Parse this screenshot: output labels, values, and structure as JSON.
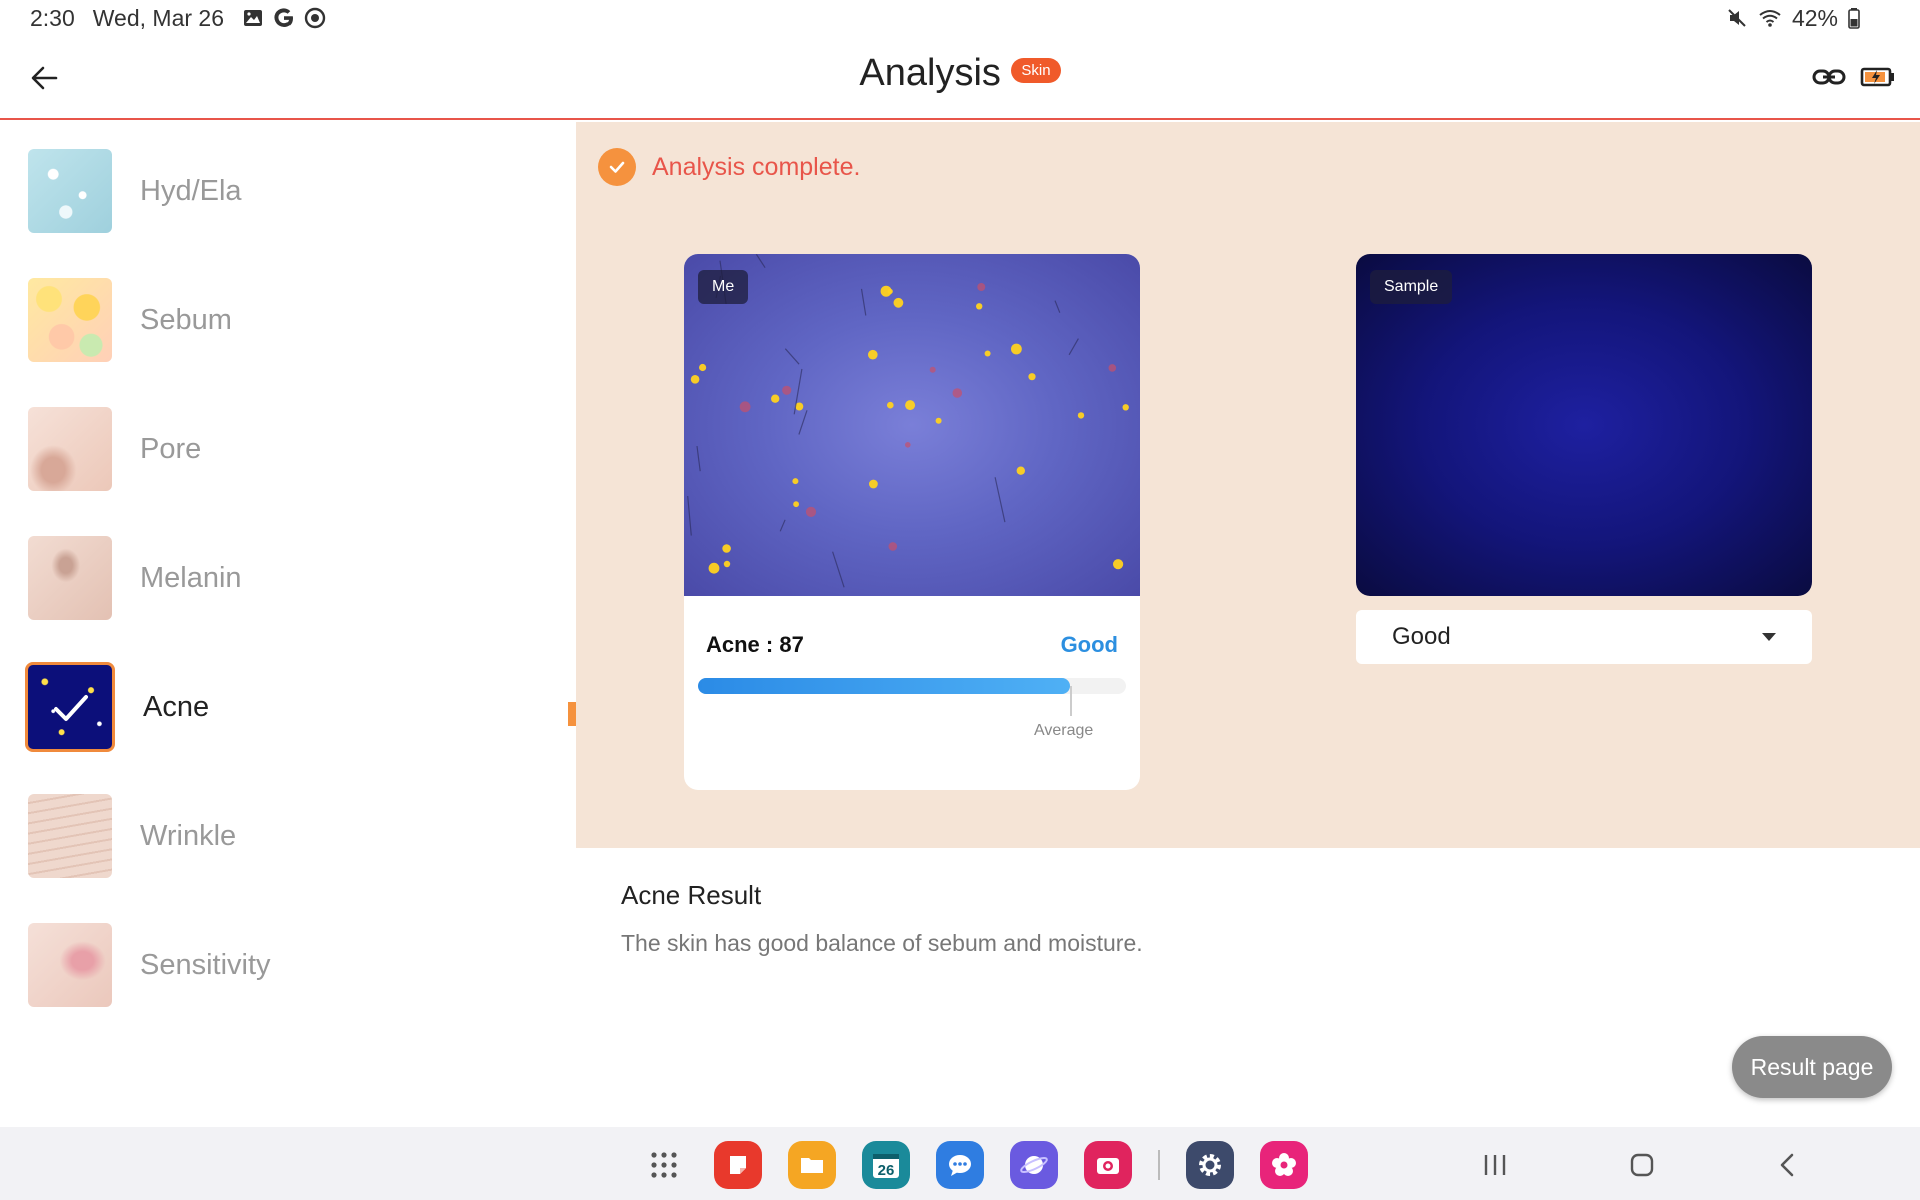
{
  "status_bar": {
    "time": "2:30",
    "date": "Wed, Mar 26",
    "battery": "42%"
  },
  "header": {
    "title": "Analysis",
    "badge": "Skin"
  },
  "sidebar": {
    "items": [
      {
        "label": "Hyd/Ela",
        "icon": "hydration-thumbnail",
        "active": false
      },
      {
        "label": "Sebum",
        "icon": "sebum-thumbnail",
        "active": false
      },
      {
        "label": "Pore",
        "icon": "pore-thumbnail",
        "active": false
      },
      {
        "label": "Melanin",
        "icon": "melanin-thumbnail",
        "active": false
      },
      {
        "label": "Acne",
        "icon": "acne-thumbnail",
        "active": true
      },
      {
        "label": "Wrinkle",
        "icon": "wrinkle-thumbnail",
        "active": false
      },
      {
        "label": "Sensitivity",
        "icon": "sensitivity-thumbnail",
        "active": false
      }
    ]
  },
  "main": {
    "status_text": "Analysis complete.",
    "me_tag": "Me",
    "sample_tag": "Sample",
    "score_label": "Acne : 87",
    "score_grade": "Good",
    "score_fraction": 0.87,
    "average_label": "Average",
    "average_fraction": 0.87,
    "dropdown_value": "Good"
  },
  "result": {
    "title": "Acne Result",
    "description": "The skin has good balance of sebum and moisture.",
    "button_label": "Result page"
  },
  "dock": {
    "calendar_day": "26"
  },
  "colors": {
    "accent": "#f5923e",
    "header_line": "#e8554a",
    "badge": "#f05a2a",
    "panel_bg": "#f5e4d6",
    "score_blue": "#2c8fe0"
  }
}
